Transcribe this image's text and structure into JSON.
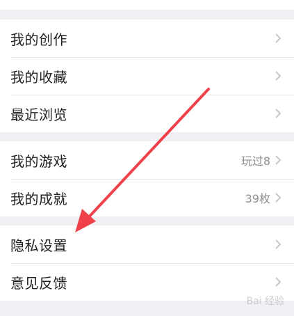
{
  "groups": [
    {
      "rows": [
        {
          "label": "我的创作",
          "value": ""
        },
        {
          "label": "我的收藏",
          "value": ""
        },
        {
          "label": "最近浏览",
          "value": ""
        }
      ]
    },
    {
      "rows": [
        {
          "label": "我的游戏",
          "value": "玩过8"
        },
        {
          "label": "我的成就",
          "value": "39枚"
        }
      ]
    },
    {
      "rows": [
        {
          "label": "隐私设置",
          "value": ""
        },
        {
          "label": "意见反馈",
          "value": ""
        }
      ]
    }
  ],
  "annotation": {
    "color": "#f0414a"
  },
  "watermark": {
    "text": "Bai 经验"
  },
  "colors": {
    "background": "#efeff4",
    "row": "#ffffff",
    "chevron": "#c7c7cc"
  }
}
